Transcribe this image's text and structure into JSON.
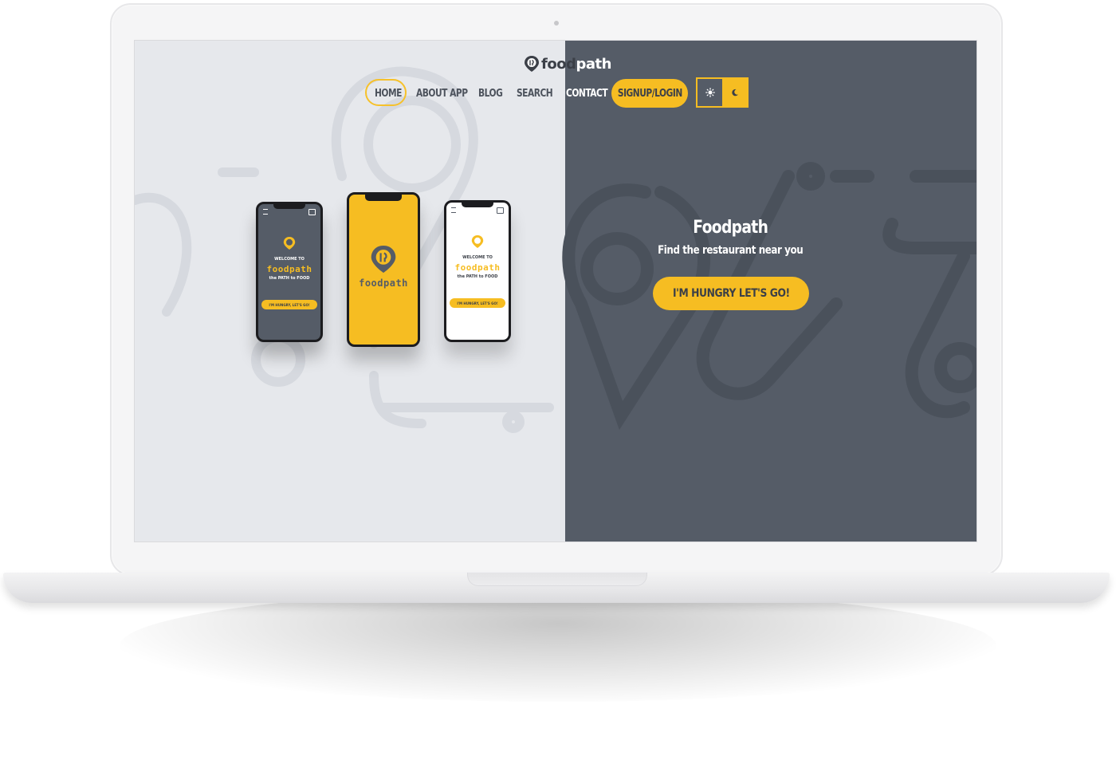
{
  "brand": {
    "logo_food": "food",
    "logo_path": "path",
    "accent": "#f6bd22",
    "dark_bg": "#555c67",
    "light_bg": "#e6e8ec"
  },
  "nav": {
    "items": [
      {
        "label": "HOME",
        "active": true
      },
      {
        "label": "ABOUT APP"
      },
      {
        "label": "BLOG"
      },
      {
        "label": "SEARCH"
      },
      {
        "label": "CONTACT"
      }
    ],
    "signup_label": "SIGNUP/LOGIN",
    "theme_toggle": {
      "light_icon": "sun-icon",
      "dark_icon": "moon-icon",
      "selected": "dark"
    }
  },
  "hero": {
    "title": "Foodpath",
    "subtitle": "Find the restaurant near you",
    "cta_label": "I'M HUNGRY LET'S GO!"
  },
  "phones": {
    "left": {
      "welcome": "WELCOME TO",
      "logo": "foodpath",
      "tagline": "the PATH to FOOD",
      "button": "I'M HUNGRY, LET'S GO!"
    },
    "center": {
      "logo": "foodpath"
    },
    "right": {
      "welcome": "WELCOME TO",
      "logo": "foodpath",
      "tagline": "the PATH to FOOD",
      "button": "I'M HUNGRY, LET'S GO!"
    }
  }
}
